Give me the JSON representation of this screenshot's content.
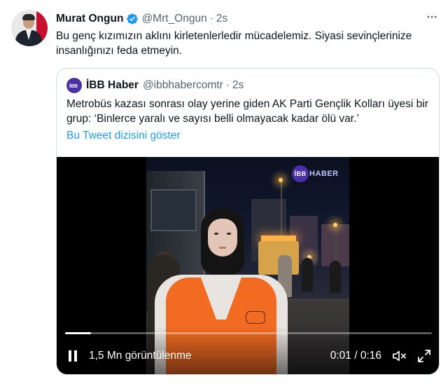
{
  "tweet": {
    "author_name": "Murat Ongun",
    "handle": "@Mrt_Ongun",
    "separator": "·",
    "time": "2s",
    "text": "Bu genç kızımızın aklını kirletenlerledir mücadelemiz. Siyasi sevinçlerinize insanlığınızı feda etmeyin.",
    "verified": true,
    "more_icon": "more-horizontal-icon"
  },
  "quote": {
    "author_name": "İBB Haber",
    "handle": "@ibbhabercomtr",
    "separator": "·",
    "time": "2s",
    "text": "Metrobüs kazası sonrası olay yerine giden AK Parti Gençlik Kolları üyesi bir grup: ‘Binlerce yaralı ve sayısı belli olmayacak kadar ölü var.’",
    "thread_link": "Bu Tweet dizisini göster"
  },
  "video": {
    "watermark": "HABER",
    "watermark_badge": "İBB",
    "views": "1,5 Mn görüntülenme",
    "current_time": "0:01",
    "time_separator": "/",
    "duration": "0:16",
    "progress": 0.07,
    "state": "playing"
  },
  "colors": {
    "accent": "#1d9bf0",
    "text_primary": "#0f1419",
    "text_secondary": "#536471",
    "border": "#cfd9de",
    "brand_ibb": "#4b2fa6",
    "vest": "#f26b22"
  }
}
